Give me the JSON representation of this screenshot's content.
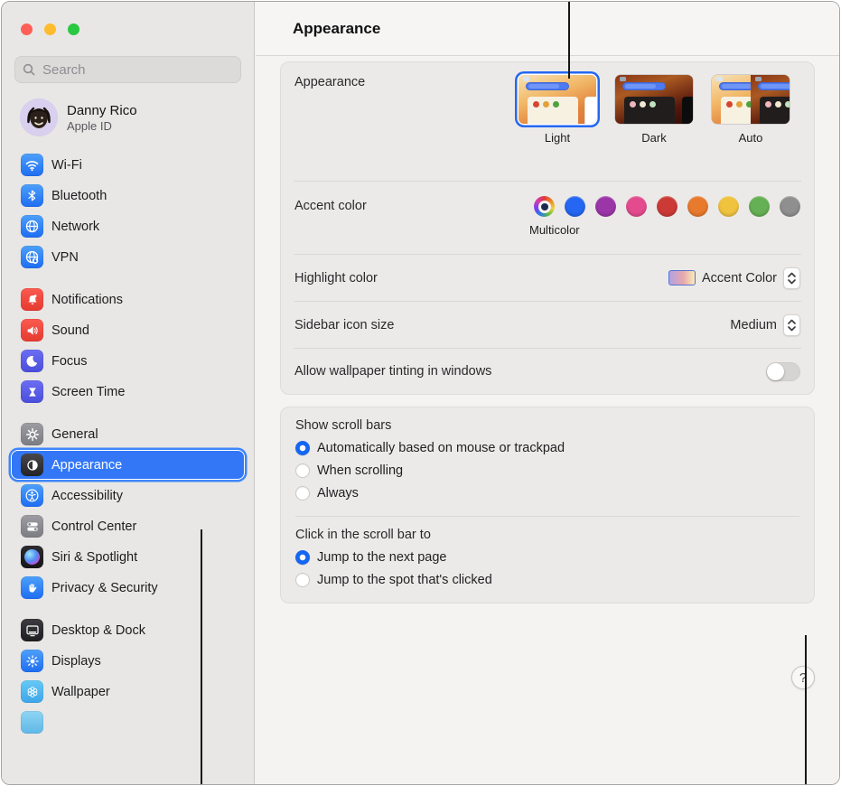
{
  "window": {
    "traffic_lights": [
      {
        "name": "close",
        "color": "#fe5f57"
      },
      {
        "name": "minimize",
        "color": "#febb2e"
      },
      {
        "name": "zoom",
        "color": "#28c840"
      }
    ]
  },
  "sidebar": {
    "search": {
      "placeholder": "Search"
    },
    "profile": {
      "name": "Danny Rico",
      "subtitle": "Apple ID"
    },
    "groups": [
      [
        {
          "id": "wifi",
          "label": "Wi-Fi",
          "icon": "wifi",
          "bg": [
            "#4da0fa",
            "#1e6df2"
          ]
        },
        {
          "id": "bluetooth",
          "label": "Bluetooth",
          "icon": "bluetooth",
          "bg": [
            "#4da0fa",
            "#1e6df2"
          ]
        },
        {
          "id": "network",
          "label": "Network",
          "icon": "globe",
          "bg": [
            "#4da0fa",
            "#1e6df2"
          ]
        },
        {
          "id": "vpn",
          "label": "VPN",
          "icon": "vpn",
          "bg": [
            "#4da0fa",
            "#1e6df2"
          ]
        }
      ],
      [
        {
          "id": "notifications",
          "label": "Notifications",
          "icon": "bell",
          "bg": [
            "#fb5a50",
            "#e53a30"
          ]
        },
        {
          "id": "sound",
          "label": "Sound",
          "icon": "speaker",
          "bg": [
            "#fb5a50",
            "#e53a30"
          ]
        },
        {
          "id": "focus",
          "label": "Focus",
          "icon": "moon",
          "bg": [
            "#6b6ef3",
            "#4b4eda"
          ]
        },
        {
          "id": "screen-time",
          "label": "Screen Time",
          "icon": "hourglass",
          "bg": [
            "#6b6ef3",
            "#4b4eda"
          ]
        }
      ],
      [
        {
          "id": "general",
          "label": "General",
          "icon": "gear",
          "bg": [
            "#9c9ca2",
            "#7c7c83"
          ]
        },
        {
          "id": "appearance",
          "label": "Appearance",
          "icon": "appearance",
          "bg": [
            "#48484c",
            "#242428"
          ],
          "selected": true
        },
        {
          "id": "accessibility",
          "label": "Accessibility",
          "icon": "accessibility",
          "bg": [
            "#4da0fa",
            "#1e6df2"
          ]
        },
        {
          "id": "control-center",
          "label": "Control Center",
          "icon": "toggles",
          "bg": [
            "#9c9ca2",
            "#7c7c83"
          ]
        },
        {
          "id": "siri-spotlight",
          "label": "Siri & Spotlight",
          "icon": "siri",
          "bg": [
            "#2c2c2e",
            "#161618"
          ]
        },
        {
          "id": "privacy-security",
          "label": "Privacy & Security",
          "icon": "hand",
          "bg": [
            "#4da0fa",
            "#1e6df2"
          ]
        }
      ],
      [
        {
          "id": "desktop-dock",
          "label": "Desktop & Dock",
          "icon": "desktop",
          "bg": [
            "#3c3c40",
            "#1e1e22"
          ]
        },
        {
          "id": "displays",
          "label": "Displays",
          "icon": "sun",
          "bg": [
            "#4da0fa",
            "#1e6df2"
          ]
        },
        {
          "id": "wallpaper",
          "label": "Wallpaper",
          "icon": "flower",
          "bg": [
            "#66c9f6",
            "#3da6e9"
          ]
        },
        {
          "id": "clipped-item",
          "label": "",
          "icon": "none",
          "bg": [
            "#8fd4f2",
            "#5fb8e8"
          ]
        }
      ]
    ]
  },
  "header": {
    "title": "Appearance"
  },
  "panel": {
    "appearance_label": "Appearance",
    "themes": [
      {
        "id": "light",
        "label": "Light",
        "selected": true
      },
      {
        "id": "dark",
        "label": "Dark",
        "selected": false
      },
      {
        "id": "auto",
        "label": "Auto",
        "selected": false
      }
    ],
    "accent_label": "Accent color",
    "accent_selected": "multicolor",
    "accent_colors": [
      {
        "name": "multicolor",
        "hex": "conic-rainbow",
        "caption": "Multicolor"
      },
      {
        "name": "blue",
        "hex": "#2567f2"
      },
      {
        "name": "purple",
        "hex": "#9b36a8"
      },
      {
        "name": "pink",
        "hex": "#e34b8e"
      },
      {
        "name": "red",
        "hex": "#cc3a36"
      },
      {
        "name": "orange",
        "hex": "#e87a2e"
      },
      {
        "name": "yellow",
        "hex": "#f0c33f"
      },
      {
        "name": "green",
        "hex": "#65b054"
      },
      {
        "name": "gray",
        "hex": "#8f8f8f"
      }
    ],
    "multicolor_label": "Multicolor",
    "highlight_label": "Highlight color",
    "highlight_value": "Accent Color",
    "sidebar_size_label": "Sidebar icon size",
    "sidebar_size_value": "Medium",
    "tinting_label": "Allow wallpaper tinting in windows",
    "tinting_on": false,
    "scroll_bars": {
      "title": "Show scroll bars",
      "options": [
        {
          "label": "Automatically based on mouse or trackpad",
          "selected": true
        },
        {
          "label": "When scrolling",
          "selected": false
        },
        {
          "label": "Always",
          "selected": false
        }
      ]
    },
    "scroll_click": {
      "title": "Click in the scroll bar to",
      "options": [
        {
          "label": "Jump to the next page",
          "selected": true
        },
        {
          "label": "Jump to the spot that's clicked",
          "selected": false
        }
      ]
    },
    "help_label": "?"
  }
}
